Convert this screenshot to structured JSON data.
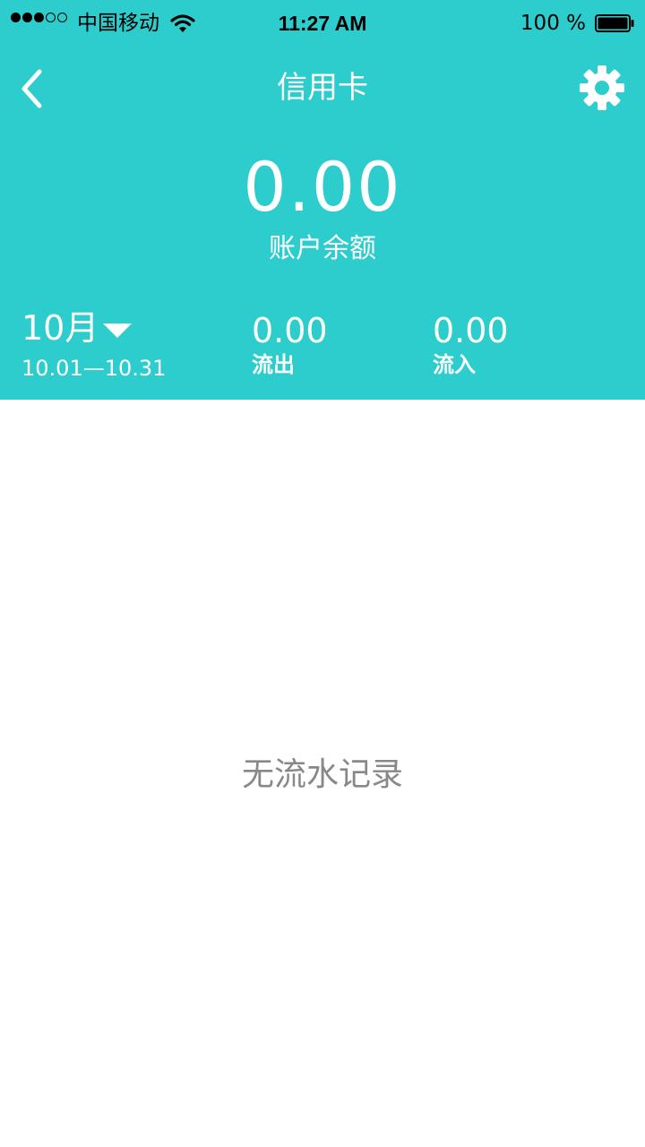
{
  "status_bar": {
    "carrier": "中国移动",
    "time": "11:27 AM",
    "battery": "100 %",
    "signal_bars_filled": 3,
    "signal_bars_total": 5,
    "battery_level": 1.0
  },
  "nav": {
    "title": "信用卡",
    "back_icon": "chevron-left-icon",
    "settings_icon": "gear-icon"
  },
  "balance": {
    "amount": "0.00",
    "label": "账户余额"
  },
  "summary": {
    "month": "10月",
    "date_range": "10.01—10.31",
    "outflow_value": "0.00",
    "outflow_label": "流出",
    "inflow_value": "0.00",
    "inflow_label": "流入"
  },
  "empty_state": {
    "message": "无流水记录"
  },
  "colors": {
    "accent": "#2ecdcd",
    "empty_text": "#888888"
  }
}
